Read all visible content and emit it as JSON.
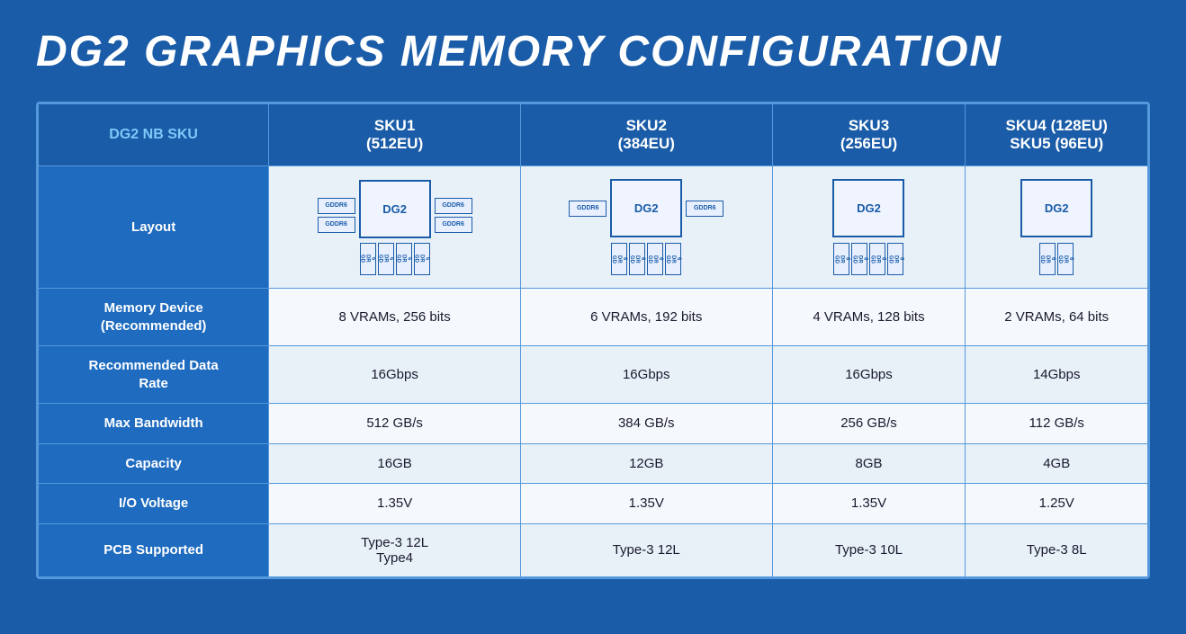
{
  "title": "DG2 Graphics Memory Configuration",
  "table": {
    "columns": [
      {
        "key": "label",
        "header": "DG2 NB SKU"
      },
      {
        "key": "sku1",
        "header": "SKU1\n(512EU)"
      },
      {
        "key": "sku2",
        "header": "SKU2\n(384EU)"
      },
      {
        "key": "sku3",
        "header": "SKU3\n(256EU)"
      },
      {
        "key": "sku4",
        "header": "SKU4 (128EU)\nSKU5 (96EU)"
      }
    ],
    "rows": [
      {
        "label": "Layout",
        "sku1": "",
        "sku2": "",
        "sku3": "",
        "sku4": "",
        "isLayout": true
      },
      {
        "label": "Memory Device\n(Recommended)",
        "sku1": "8 VRAMs, 256 bits",
        "sku2": "6 VRAMs, 192 bits",
        "sku3": "4 VRAMs, 128 bits",
        "sku4": "2 VRAMs, 64 bits"
      },
      {
        "label": "Recommended Data\nRate",
        "sku1": "16Gbps",
        "sku2": "16Gbps",
        "sku3": "16Gbps",
        "sku4": "14Gbps"
      },
      {
        "label": "Max Bandwidth",
        "sku1": "512 GB/s",
        "sku2": "384 GB/s",
        "sku3": "256 GB/s",
        "sku4": "112 GB/s"
      },
      {
        "label": "Capacity",
        "sku1": "16GB",
        "sku2": "12GB",
        "sku3": "8GB",
        "sku4": "4GB"
      },
      {
        "label": "I/O Voltage",
        "sku1": "1.35V",
        "sku2": "1.35V",
        "sku3": "1.35V",
        "sku4": "1.25V"
      },
      {
        "label": "PCB Supported",
        "sku1": "Type-3 12L\nType4",
        "sku2": "Type-3 12L",
        "sku3": "Type-3 10L",
        "sku4": "Type-3 8L"
      }
    ],
    "headers": {
      "col0": "DG2 NB SKU",
      "col1": "SKU1",
      "col1b": "(512EU)",
      "col2": "SKU2",
      "col2b": "(384EU)",
      "col3": "SKU3",
      "col3b": "(256EU)",
      "col4": "SKU4 (128EU)",
      "col4b": "SKU5 (96EU)"
    }
  }
}
